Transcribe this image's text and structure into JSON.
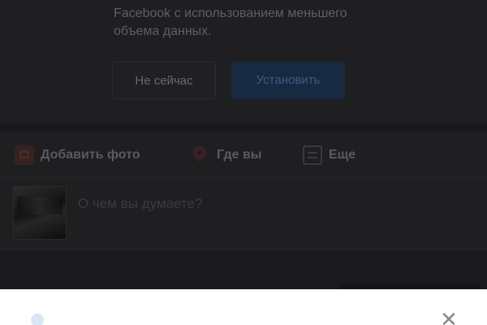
{
  "promo": {
    "line1": "Facebook с использованием меньшего",
    "line2": "объема данных.",
    "later_label": "Не сейчас",
    "install_label": "Установить"
  },
  "composer": {
    "actions": [
      {
        "label": "Добавить фото",
        "icon": "photo-icon"
      },
      {
        "label": "Где вы",
        "icon": "location-pin-icon"
      },
      {
        "label": "Еще",
        "icon": "more-icon"
      }
    ],
    "placeholder": "О чем вы думаете?"
  },
  "sheet": {
    "text": "",
    "close_glyph": "✕"
  },
  "colors": {
    "overlay_bg": "#1c1c1e",
    "install_button": "#182a42",
    "sheet_bg": "#ffffff"
  }
}
